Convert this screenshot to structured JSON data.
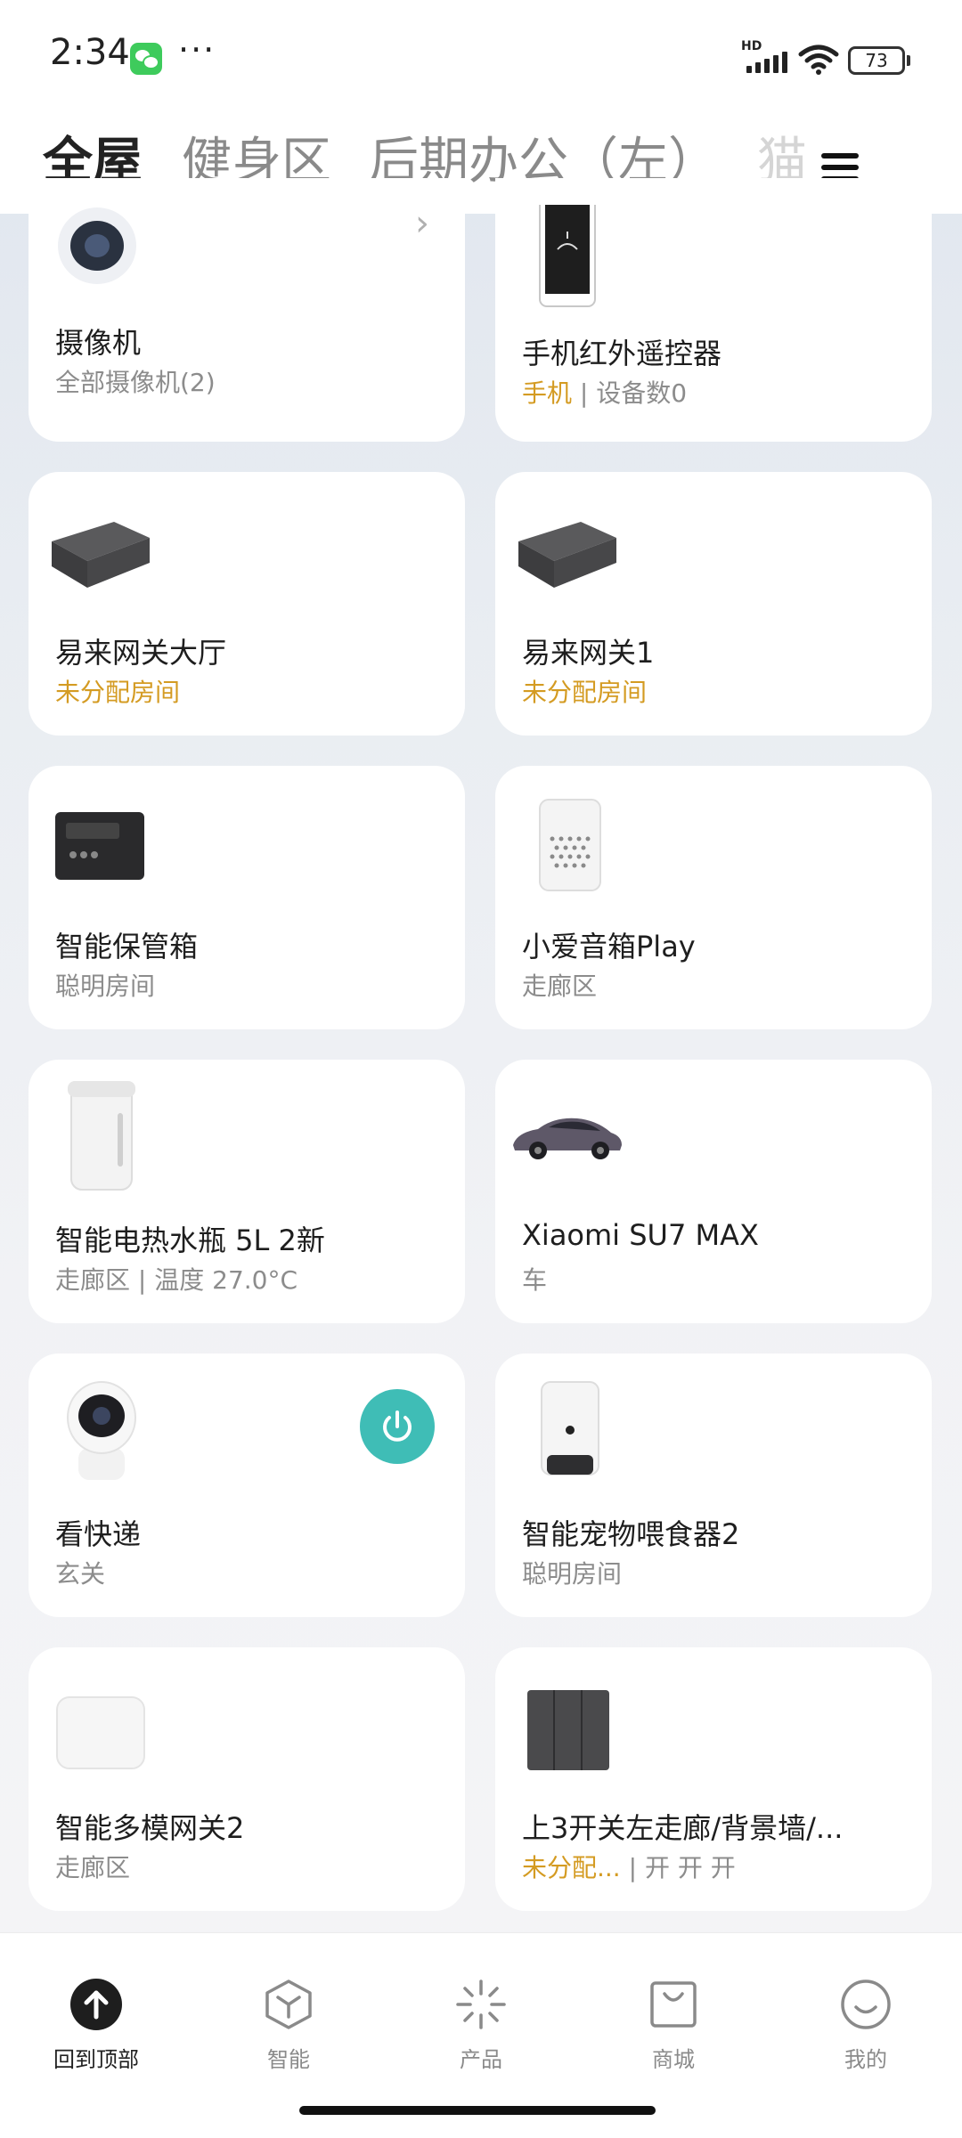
{
  "status": {
    "time": "2:34",
    "battery": "73",
    "network_label": "HD"
  },
  "tabs": [
    {
      "label": "全屋",
      "active": true
    },
    {
      "label": "健身区"
    },
    {
      "label": "后期办公（左）"
    },
    {
      "label": "猫"
    }
  ],
  "devices": [
    {
      "name": "摄像机",
      "sub": "全部摄像机(2)"
    },
    {
      "name": "手机红外遥控器",
      "sub_highlight": "手机",
      "sub": "设备数0"
    },
    {
      "name": "易来网关大厅",
      "sub_highlight": "未分配房间"
    },
    {
      "name": "易来网关1",
      "sub_highlight": "未分配房间"
    },
    {
      "name": "智能保管箱",
      "sub": "聪明房间"
    },
    {
      "name": "小爱音箱Play",
      "sub": "走廊区"
    },
    {
      "name": "智能电热水瓶 5L 2新",
      "sub": "走廊区 | 温度 27.0°C"
    },
    {
      "name": "Xiaomi SU7 MAX",
      "sub": "车"
    },
    {
      "name": "看快递",
      "sub": "玄关"
    },
    {
      "name": "智能宠物喂食器2",
      "sub": "聪明房间"
    },
    {
      "name": "智能多模网关2",
      "sub": "走廊区"
    },
    {
      "name": "上3开关左走廊/背景墙/...",
      "sub_highlight": "未分配...",
      "sub": "开 开 开"
    }
  ],
  "bottom_nav": [
    {
      "label": "回到顶部",
      "icon": "arrow-up-icon",
      "active": true
    },
    {
      "label": "智能",
      "icon": "cube-icon"
    },
    {
      "label": "产品",
      "icon": "sparkle-icon"
    },
    {
      "label": "商城",
      "icon": "shopping-bag-icon"
    },
    {
      "label": "我的",
      "icon": "smiley-icon"
    }
  ],
  "colors": {
    "accent_teal": "#3fbdb6",
    "highlight_orange": "#d49b22",
    "wechat_green": "#3ecb5c"
  }
}
